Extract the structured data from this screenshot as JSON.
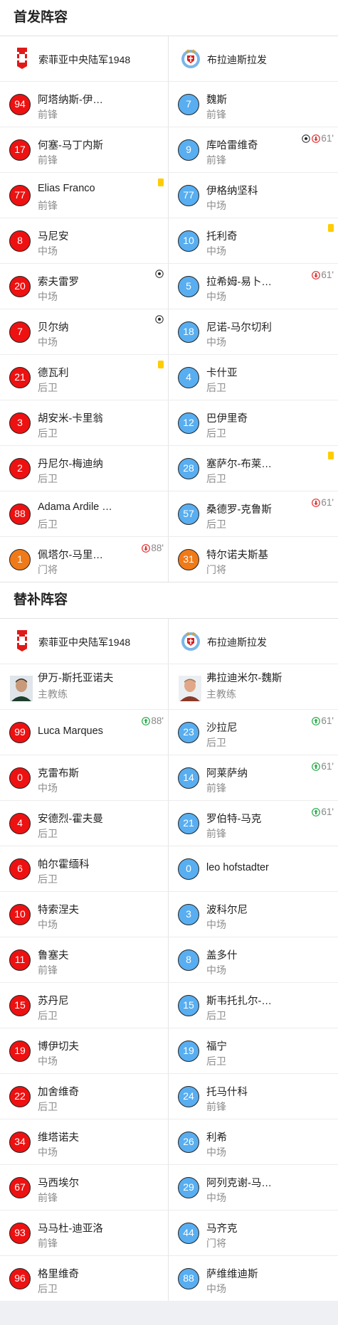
{
  "starting": {
    "title": "首发阵容",
    "home_team": "索菲亚中央陆军1948",
    "away_team": "布拉迪斯拉发",
    "rows": [
      {
        "home": {
          "num": "94",
          "name": "阿塔纳斯-伊…",
          "pos": "前锋",
          "color": "red",
          "events": []
        },
        "away": {
          "num": "7",
          "name": "魏斯",
          "pos": "前锋",
          "color": "blue",
          "events": []
        }
      },
      {
        "home": {
          "num": "17",
          "name": "何塞-马丁内斯",
          "pos": "前锋",
          "color": "red",
          "events": []
        },
        "away": {
          "num": "9",
          "name": "库哈雷维奇",
          "pos": "前锋",
          "color": "blue",
          "events": [
            {
              "type": "goal"
            },
            {
              "type": "sub_out",
              "time": "61'"
            }
          ]
        }
      },
      {
        "home": {
          "num": "77",
          "name": "Elias Franco",
          "pos": "前锋",
          "color": "red",
          "events": [
            {
              "type": "yellow"
            }
          ]
        },
        "away": {
          "num": "77",
          "name": "伊格纳坚科",
          "pos": "中场",
          "color": "blue",
          "events": []
        }
      },
      {
        "home": {
          "num": "8",
          "name": "马尼安",
          "pos": "中场",
          "color": "red",
          "events": []
        },
        "away": {
          "num": "10",
          "name": "托利奇",
          "pos": "中场",
          "color": "blue",
          "events": [
            {
              "type": "yellow"
            }
          ]
        }
      },
      {
        "home": {
          "num": "20",
          "name": "索夫雷罗",
          "pos": "中场",
          "color": "red",
          "events": [
            {
              "type": "goal"
            }
          ]
        },
        "away": {
          "num": "5",
          "name": "拉希姆-易卜…",
          "pos": "中场",
          "color": "blue",
          "events": [
            {
              "type": "sub_out",
              "time": "61'"
            }
          ]
        }
      },
      {
        "home": {
          "num": "7",
          "name": "贝尔纳",
          "pos": "中场",
          "color": "red",
          "events": [
            {
              "type": "goal"
            }
          ]
        },
        "away": {
          "num": "18",
          "name": "尼诺-马尔切利",
          "pos": "中场",
          "color": "blue",
          "events": []
        }
      },
      {
        "home": {
          "num": "21",
          "name": "德瓦利",
          "pos": "后卫",
          "color": "red",
          "events": [
            {
              "type": "yellow"
            }
          ]
        },
        "away": {
          "num": "4",
          "name": "卡什亚",
          "pos": "后卫",
          "color": "blue",
          "events": []
        }
      },
      {
        "home": {
          "num": "3",
          "name": "胡安米-卡里翁",
          "pos": "后卫",
          "color": "red",
          "events": []
        },
        "away": {
          "num": "12",
          "name": "巴伊里奇",
          "pos": "后卫",
          "color": "blue",
          "events": []
        }
      },
      {
        "home": {
          "num": "2",
          "name": "丹尼尔-梅迪纳",
          "pos": "后卫",
          "color": "red",
          "events": []
        },
        "away": {
          "num": "28",
          "name": "塞萨尔-布莱…",
          "pos": "后卫",
          "color": "blue",
          "events": [
            {
              "type": "yellow"
            }
          ]
        }
      },
      {
        "home": {
          "num": "88",
          "name": "Adama Ardile …",
          "pos": "后卫",
          "color": "red",
          "events": []
        },
        "away": {
          "num": "57",
          "name": "桑德罗-克鲁斯",
          "pos": "后卫",
          "color": "blue",
          "events": [
            {
              "type": "sub_out",
              "time": "61'"
            }
          ]
        }
      },
      {
        "home": {
          "num": "1",
          "name": "佩塔尔-马里…",
          "pos": "门将",
          "color": "orange",
          "events": [
            {
              "type": "sub_out",
              "time": "88'"
            }
          ]
        },
        "away": {
          "num": "31",
          "name": "特尔诺夫斯基",
          "pos": "门将",
          "color": "orange",
          "events": []
        }
      }
    ]
  },
  "subs": {
    "title": "替补阵容",
    "home_team": "索菲亚中央陆军1948",
    "away_team": "布拉迪斯拉发",
    "home_coach": {
      "name": "伊万-斯托亚诺夫",
      "role": "主教练"
    },
    "away_coach": {
      "name": "弗拉迪米尔-魏斯",
      "role": "主教练"
    },
    "rows": [
      {
        "home": {
          "num": "99",
          "name": "Luca Marques",
          "pos": "",
          "color": "red",
          "events": [
            {
              "type": "sub_in",
              "time": "88'"
            }
          ]
        },
        "away": {
          "num": "23",
          "name": "沙拉尼",
          "pos": "后卫",
          "color": "blue",
          "events": [
            {
              "type": "sub_in",
              "time": "61'"
            }
          ]
        }
      },
      {
        "home": {
          "num": "0",
          "name": "克雷布斯",
          "pos": "中场",
          "color": "red",
          "events": []
        },
        "away": {
          "num": "14",
          "name": "阿莱萨纳",
          "pos": "前锋",
          "color": "blue",
          "events": [
            {
              "type": "sub_in",
              "time": "61'"
            }
          ]
        }
      },
      {
        "home": {
          "num": "4",
          "name": "安德烈-霍夫曼",
          "pos": "后卫",
          "color": "red",
          "events": []
        },
        "away": {
          "num": "21",
          "name": "罗伯特-马克",
          "pos": "前锋",
          "color": "blue",
          "events": [
            {
              "type": "sub_in",
              "time": "61'"
            }
          ]
        }
      },
      {
        "home": {
          "num": "6",
          "name": "帕尔霍缅科",
          "pos": "后卫",
          "color": "red",
          "events": []
        },
        "away": {
          "num": "0",
          "name": "leo hofstadter",
          "pos": "",
          "color": "blue",
          "events": []
        }
      },
      {
        "home": {
          "num": "10",
          "name": "特索涅夫",
          "pos": "中场",
          "color": "red",
          "events": []
        },
        "away": {
          "num": "3",
          "name": "波科尔尼",
          "pos": "中场",
          "color": "blue",
          "events": []
        }
      },
      {
        "home": {
          "num": "11",
          "name": "鲁塞夫",
          "pos": "前锋",
          "color": "red",
          "events": []
        },
        "away": {
          "num": "8",
          "name": "盖多什",
          "pos": "中场",
          "color": "blue",
          "events": []
        }
      },
      {
        "home": {
          "num": "15",
          "name": "苏丹尼",
          "pos": "后卫",
          "color": "red",
          "events": []
        },
        "away": {
          "num": "15",
          "name": "斯韦托扎尔-…",
          "pos": "后卫",
          "color": "blue",
          "events": []
        }
      },
      {
        "home": {
          "num": "19",
          "name": "博伊切夫",
          "pos": "中场",
          "color": "red",
          "events": []
        },
        "away": {
          "num": "19",
          "name": "福宁",
          "pos": "后卫",
          "color": "blue",
          "events": []
        }
      },
      {
        "home": {
          "num": "22",
          "name": "加舍维奇",
          "pos": "后卫",
          "color": "red",
          "events": []
        },
        "away": {
          "num": "24",
          "name": "托马什科",
          "pos": "前锋",
          "color": "blue",
          "events": []
        }
      },
      {
        "home": {
          "num": "34",
          "name": "维塔诺夫",
          "pos": "中场",
          "color": "red",
          "events": []
        },
        "away": {
          "num": "26",
          "name": "利希",
          "pos": "中场",
          "color": "blue",
          "events": []
        }
      },
      {
        "home": {
          "num": "67",
          "name": "马西埃尔",
          "pos": "前锋",
          "color": "red",
          "events": []
        },
        "away": {
          "num": "29",
          "name": "阿列克谢-马…",
          "pos": "中场",
          "color": "blue",
          "events": []
        }
      },
      {
        "home": {
          "num": "93",
          "name": "马马杜-迪亚洛",
          "pos": "前锋",
          "color": "red",
          "events": []
        },
        "away": {
          "num": "44",
          "name": "马齐克",
          "pos": "门将",
          "color": "blue",
          "events": []
        }
      },
      {
        "home": {
          "num": "96",
          "name": "格里维奇",
          "pos": "后卫",
          "color": "red",
          "events": []
        },
        "away": {
          "num": "88",
          "name": "萨维维迪斯",
          "pos": "中场",
          "color": "blue",
          "events": []
        }
      }
    ]
  }
}
